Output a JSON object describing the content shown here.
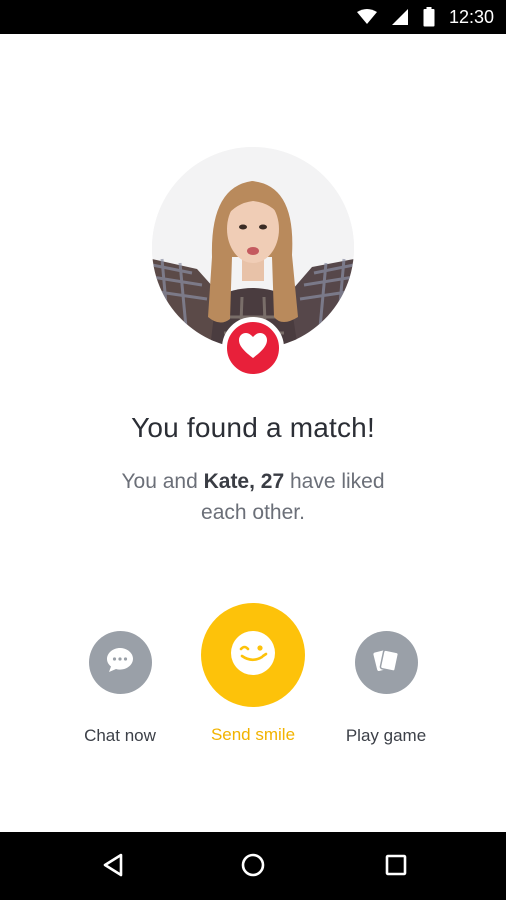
{
  "status_bar": {
    "time": "12:30",
    "icons": [
      "wifi-icon",
      "signal-icon",
      "battery-icon"
    ]
  },
  "match": {
    "title": "You found a match!",
    "subtitle_prefix": "You and ",
    "match_name": "Kate, 27",
    "subtitle_suffix": " have liked each other."
  },
  "actions": {
    "chat_label": "Chat now",
    "smile_label": "Send smile",
    "game_label": "Play game"
  },
  "colors": {
    "heart": "#e8203a",
    "smile_accent": "#fdc20a",
    "secondary_button": "#9aa0a8"
  },
  "nav_bar": {
    "icons": [
      "back-icon",
      "home-icon",
      "recents-icon"
    ]
  }
}
